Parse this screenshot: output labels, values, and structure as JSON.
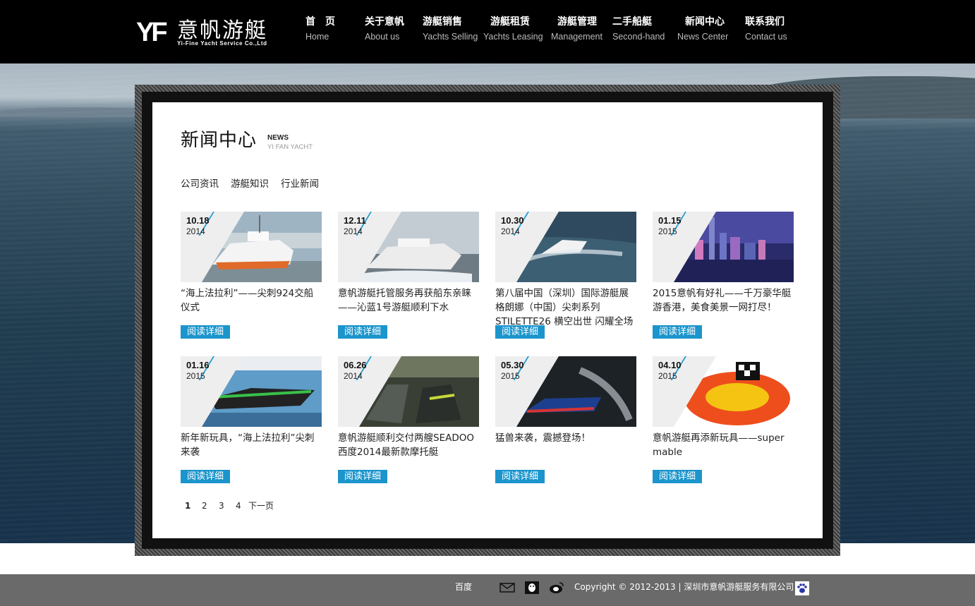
{
  "logo": {
    "mark": "YF",
    "name": "意帆游艇",
    "tagline": "Yi-Fine Yacht Service Co.,Ltd"
  },
  "nav": [
    {
      "cn": "首　页",
      "en": "Home"
    },
    {
      "cn": "关于意帆",
      "en": "About us"
    },
    {
      "cn": "游艇销售",
      "en": "Yachts Selling"
    },
    {
      "cn": "游艇租赁",
      "en": "Yachts Leasing"
    },
    {
      "cn": "游艇管理",
      "en": "Management"
    },
    {
      "cn": "二手船艇",
      "en": "Second-hand"
    },
    {
      "cn": "新闻中心",
      "en": "News Center"
    },
    {
      "cn": "联系我们",
      "en": "Contact us"
    }
  ],
  "section": {
    "title": "新闻中心",
    "en_title": "NEWS",
    "en_sub": "YI FAN YACHT"
  },
  "subnav": [
    "公司资讯",
    "游艇知识",
    "行业新闻"
  ],
  "read_more": "阅读详细",
  "news": [
    {
      "date": "10.18",
      "year": "2014",
      "title": "“海上法拉利”——尖刺924交船仪式"
    },
    {
      "date": "12.11",
      "year": "2014",
      "title": "意帆游艇托管服务再获船东亲睐——沁蓝1号游艇顺利下水"
    },
    {
      "date": "10.30",
      "year": "2014",
      "title": "第八届中国（深圳）国际游艇展格朗娜（中国）尖刺系列STILETTE26 横空出世 闪耀全场"
    },
    {
      "date": "01.15",
      "year": "2015",
      "title": "2015意帆有好礼——千万豪华艇游香港，美食美景一网打尽！"
    },
    {
      "date": "01.16",
      "year": "2015",
      "title": "新年新玩具，“海上法拉利”尖刺来袭"
    },
    {
      "date": "06.26",
      "year": "2014",
      "title": "意帆游艇顺利交付两艘SEADOO西度2014最新款摩托艇"
    },
    {
      "date": "05.30",
      "year": "2015",
      "title": "猛兽来袭，震撼登场！"
    },
    {
      "date": "04.10",
      "year": "2015",
      "title": "意帆游艇再添新玩具——super mable"
    }
  ],
  "pager": [
    "1",
    "2",
    "3",
    "4",
    "下一页"
  ],
  "footer": {
    "baidu": "百度",
    "copyright": "Copyright © 2012-2013 | 深圳市意帆游艇服务有限公司"
  },
  "colors": {
    "header_bg": "#000000",
    "accent": "#1b95cc",
    "footer_bg": "#6a6a6a"
  }
}
